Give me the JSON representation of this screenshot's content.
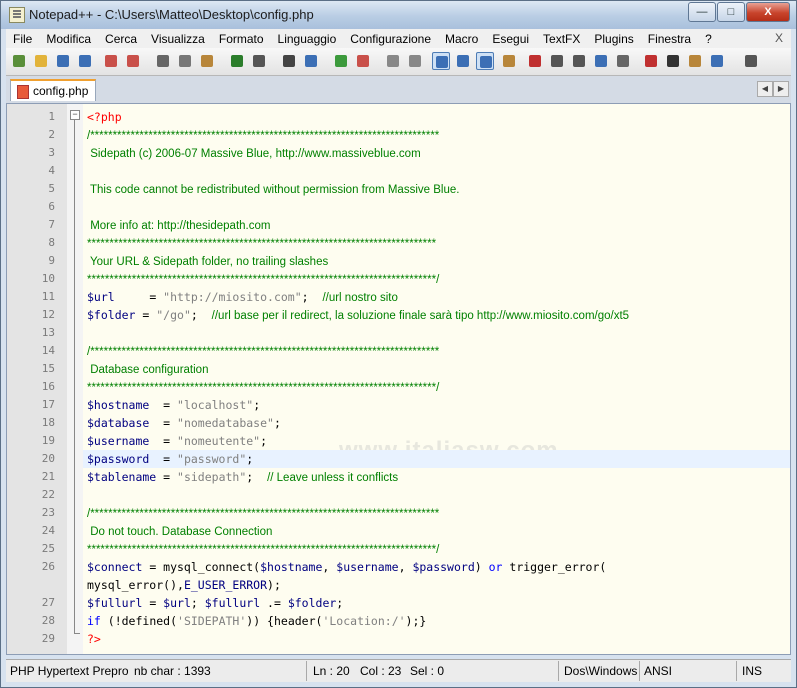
{
  "window": {
    "title": "Notepad++ - C:\\Users\\Matteo\\Desktop\\config.php",
    "controls": {
      "minimize": "—",
      "maximize": "□",
      "close": "X"
    }
  },
  "menu": {
    "items": [
      "File",
      "Modifica",
      "Cerca",
      "Visualizza",
      "Formato",
      "Linguaggio",
      "Configurazione",
      "Macro",
      "Esegui",
      "TextFX",
      "Plugins",
      "Finestra",
      "?"
    ],
    "close": "X"
  },
  "toolbar": {
    "buttons": [
      "new-file",
      "open-file",
      "save",
      "save-all",
      "close",
      "close-all",
      "cut",
      "copy",
      "paste",
      "undo",
      "redo",
      "find",
      "replace",
      "zoom-in",
      "zoom-out",
      "sync-vertical",
      "sync-horizontal",
      "word-wrap",
      "show-all-chars",
      "indent-guide",
      "user-lang",
      "record-macro",
      "stop-macro",
      "play-macro",
      "run-multi",
      "save-macro",
      "pdf",
      "html-export",
      "clipboard",
      "spell-check",
      "print"
    ]
  },
  "tab": {
    "label": "config.php",
    "scroll_left": "◀",
    "scroll_right": "▶"
  },
  "editor": {
    "watermark": "www.italiasw.com",
    "lines": [
      {
        "n": "1",
        "parts": [
          {
            "c": "tag",
            "t": "<?php"
          }
        ]
      },
      {
        "n": "2",
        "parts": [
          {
            "c": "cmt",
            "t": "/******************************************************************************"
          }
        ]
      },
      {
        "n": "3",
        "parts": [
          {
            "c": "cmt",
            "t": " Sidepath (c) 2006-07 Massive Blue, http://www.massiveblue.com"
          }
        ]
      },
      {
        "n": "4",
        "parts": []
      },
      {
        "n": "5",
        "parts": [
          {
            "c": "cmt",
            "t": " This code cannot be redistributed without permission from Massive Blue."
          }
        ]
      },
      {
        "n": "6",
        "parts": []
      },
      {
        "n": "7",
        "parts": [
          {
            "c": "cmt",
            "t": " More info at: http://thesidepath.com"
          }
        ]
      },
      {
        "n": "8",
        "parts": [
          {
            "c": "cmt",
            "t": "******************************************************************************"
          }
        ]
      },
      {
        "n": "9",
        "parts": [
          {
            "c": "cmt",
            "t": " Your URL & Sidepath folder, no trailing slashes"
          }
        ]
      },
      {
        "n": "10",
        "parts": [
          {
            "c": "cmt",
            "t": "******************************************************************************/"
          }
        ]
      },
      {
        "n": "11",
        "parts": [
          {
            "c": "var",
            "t": "$url"
          },
          {
            "c": "plain",
            "t": "     = "
          },
          {
            "c": "str",
            "t": "\"http://miosito.com\""
          },
          {
            "c": "plain",
            "t": ";  "
          },
          {
            "c": "cmt",
            "t": "//url nostro sito"
          }
        ]
      },
      {
        "n": "12",
        "parts": [
          {
            "c": "var",
            "t": "$folder"
          },
          {
            "c": "plain",
            "t": " = "
          },
          {
            "c": "str",
            "t": "\"/go\""
          },
          {
            "c": "plain",
            "t": ";  "
          },
          {
            "c": "cmt",
            "t": "//url base per il redirect, la soluzione finale sarà tipo http://www.miosito.com/go/xt5"
          }
        ]
      },
      {
        "n": "13",
        "parts": []
      },
      {
        "n": "14",
        "parts": [
          {
            "c": "cmt",
            "t": "/******************************************************************************"
          }
        ]
      },
      {
        "n": "15",
        "parts": [
          {
            "c": "cmt",
            "t": " Database configuration"
          }
        ]
      },
      {
        "n": "16",
        "parts": [
          {
            "c": "cmt",
            "t": "******************************************************************************/"
          }
        ]
      },
      {
        "n": "17",
        "parts": [
          {
            "c": "var",
            "t": "$hostname"
          },
          {
            "c": "plain",
            "t": "  = "
          },
          {
            "c": "str",
            "t": "\"localhost\""
          },
          {
            "c": "plain",
            "t": ";"
          }
        ]
      },
      {
        "n": "18",
        "parts": [
          {
            "c": "var",
            "t": "$database"
          },
          {
            "c": "plain",
            "t": "  = "
          },
          {
            "c": "str",
            "t": "\"nomedatabase\""
          },
          {
            "c": "plain",
            "t": ";"
          }
        ]
      },
      {
        "n": "19",
        "parts": [
          {
            "c": "var",
            "t": "$username"
          },
          {
            "c": "plain",
            "t": "  = "
          },
          {
            "c": "str",
            "t": "\"nomeutente\""
          },
          {
            "c": "plain",
            "t": ";"
          }
        ]
      },
      {
        "n": "20",
        "parts": [
          {
            "c": "var",
            "t": "$password"
          },
          {
            "c": "plain",
            "t": "  = "
          },
          {
            "c": "str",
            "t": "\"password\""
          },
          {
            "c": "plain",
            "t": ";"
          }
        ]
      },
      {
        "n": "21",
        "parts": [
          {
            "c": "var",
            "t": "$tablename"
          },
          {
            "c": "plain",
            "t": " = "
          },
          {
            "c": "str",
            "t": "\"sidepath\""
          },
          {
            "c": "plain",
            "t": ";  "
          },
          {
            "c": "cmt",
            "t": "// Leave unless it conflicts"
          }
        ]
      },
      {
        "n": "22",
        "parts": []
      },
      {
        "n": "23",
        "parts": [
          {
            "c": "cmt",
            "t": "/******************************************************************************"
          }
        ]
      },
      {
        "n": "24",
        "parts": [
          {
            "c": "cmt",
            "t": " Do not touch. Database Connection"
          }
        ]
      },
      {
        "n": "25",
        "parts": [
          {
            "c": "cmt",
            "t": "******************************************************************************/"
          }
        ]
      },
      {
        "n": "26",
        "parts": [
          {
            "c": "var",
            "t": "$connect"
          },
          {
            "c": "plain",
            "t": " = mysql_connect("
          },
          {
            "c": "var",
            "t": "$hostname"
          },
          {
            "c": "plain",
            "t": ", "
          },
          {
            "c": "var",
            "t": "$username"
          },
          {
            "c": "plain",
            "t": ", "
          },
          {
            "c": "var",
            "t": "$password"
          },
          {
            "c": "plain",
            "t": ") "
          },
          {
            "c": "kw",
            "t": "or"
          },
          {
            "c": "plain",
            "t": " trigger_error("
          }
        ]
      },
      {
        "n": "",
        "parts": [
          {
            "c": "plain",
            "t": "mysql_error(),"
          },
          {
            "c": "var",
            "t": "E_USER_ERROR"
          },
          {
            "c": "plain",
            "t": ");"
          }
        ]
      },
      {
        "n": "27",
        "parts": [
          {
            "c": "var",
            "t": "$fullurl"
          },
          {
            "c": "plain",
            "t": " = "
          },
          {
            "c": "var",
            "t": "$url"
          },
          {
            "c": "plain",
            "t": "; "
          },
          {
            "c": "var",
            "t": "$fullurl"
          },
          {
            "c": "plain",
            "t": " .= "
          },
          {
            "c": "var",
            "t": "$folder"
          },
          {
            "c": "plain",
            "t": ";"
          }
        ]
      },
      {
        "n": "28",
        "parts": [
          {
            "c": "kw",
            "t": "if"
          },
          {
            "c": "plain",
            "t": " (!defined("
          },
          {
            "c": "str",
            "t": "'SIDEPATH'"
          },
          {
            "c": "plain",
            "t": ")) {header("
          },
          {
            "c": "str",
            "t": "'Location:/'"
          },
          {
            "c": "plain",
            "t": ");}"
          }
        ]
      },
      {
        "n": "29",
        "parts": [
          {
            "c": "tag",
            "t": "?>"
          }
        ]
      }
    ]
  },
  "status": {
    "language": "PHP Hypertext Preproc",
    "nb_char": "nb char : 1393",
    "ln": "Ln : 20",
    "col": "Col : 23",
    "sel": "Sel : 0",
    "eol": "Dos\\Windows",
    "encoding": "ANSI",
    "mode": "INS"
  }
}
